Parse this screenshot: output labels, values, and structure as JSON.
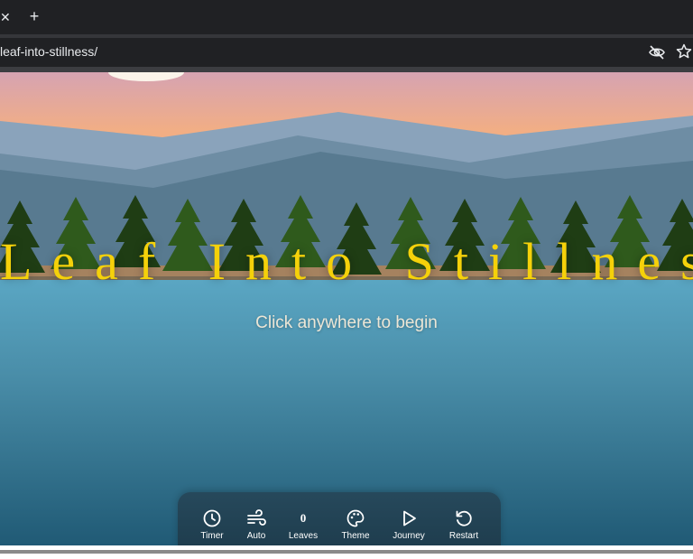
{
  "browser": {
    "tab_close_glyph": "✕",
    "new_tab_glyph": "+",
    "url": "leaf-into-stillness/",
    "icons": [
      "eye-off-icon",
      "star-icon"
    ]
  },
  "page": {
    "title": "Leaf Into Stillness",
    "subtitle": "Click anywhere to begin"
  },
  "controls": {
    "timer": "Timer",
    "auto": "Auto",
    "leaves_count": "0",
    "leaves": "Leaves",
    "theme": "Theme",
    "journey": "Journey",
    "restart": "Restart"
  },
  "colors": {
    "sky_top": "#d6a3b2",
    "sky_bottom": "#f2ae84",
    "title": "#f5d10a",
    "lake": "#4e98b5"
  }
}
